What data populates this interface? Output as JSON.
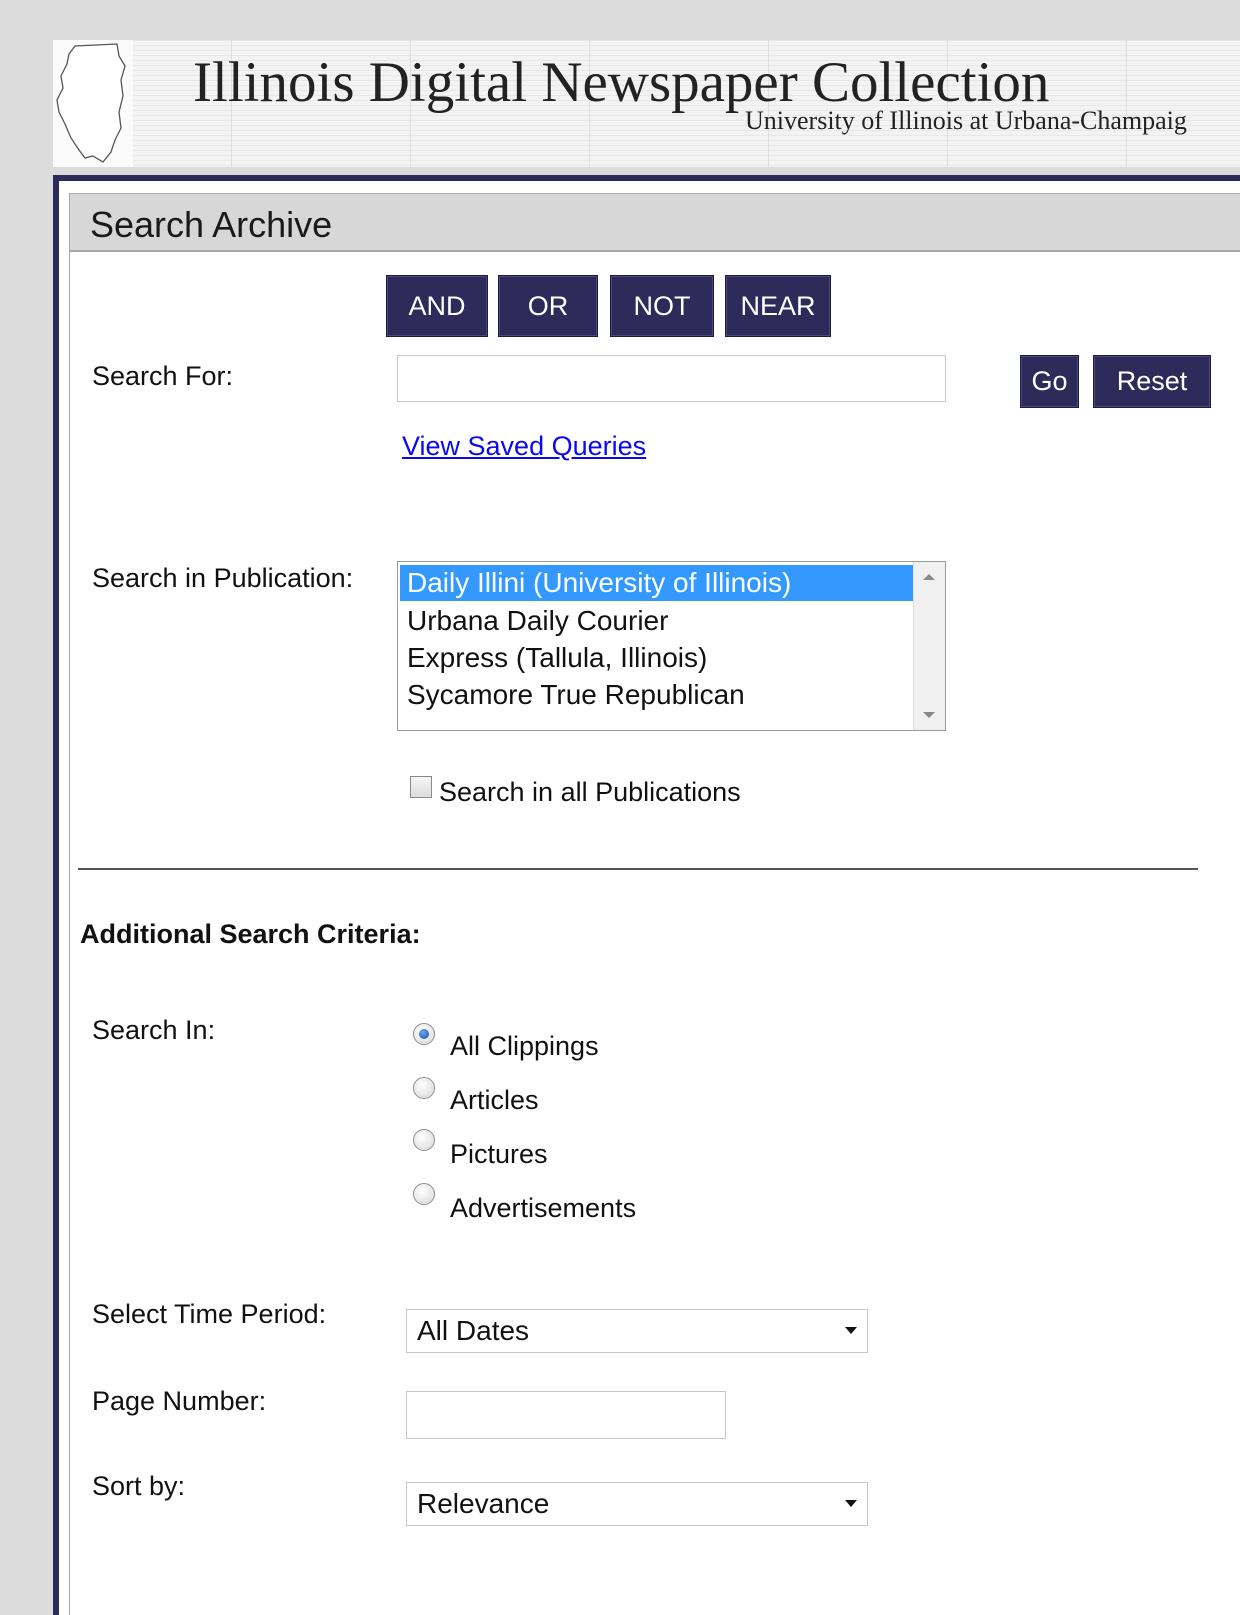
{
  "banner": {
    "title": "Illinois Digital Newspaper Collection",
    "subtitle": "University of Illinois at Urbana-Champaig"
  },
  "search": {
    "heading": "Search Archive",
    "operators": [
      "AND",
      "OR",
      "NOT",
      "NEAR"
    ],
    "search_for_label": "Search For:",
    "search_for_value": "",
    "go_label": "Go",
    "reset_label": "Reset",
    "saved_queries_link": "View Saved Queries",
    "publication_label": "Search in Publication:",
    "publications": [
      "Daily Illini (University of Illinois)",
      "Urbana Daily Courier",
      "Express (Tallula, Illinois)",
      "Sycamore True Republican"
    ],
    "selected_publication": "Daily Illini (University of Illinois)",
    "all_publications_label": "Search in all Publications",
    "all_publications_checked": false
  },
  "additional": {
    "heading": "Additional Search Criteria:",
    "search_in_label": "Search In:",
    "search_in_options": [
      "All Clippings",
      "Articles",
      "Pictures",
      "Advertisements"
    ],
    "search_in_selected": "All Clippings",
    "time_period_label": "Select Time Period:",
    "time_period_value": "All Dates",
    "page_number_label": "Page Number:",
    "page_number_value": "",
    "sort_label": "Sort by:",
    "sort_value": "Relevance"
  },
  "colors": {
    "accent": "#2e2b5a",
    "selection": "#3399ff",
    "link": "#0a0aee"
  }
}
